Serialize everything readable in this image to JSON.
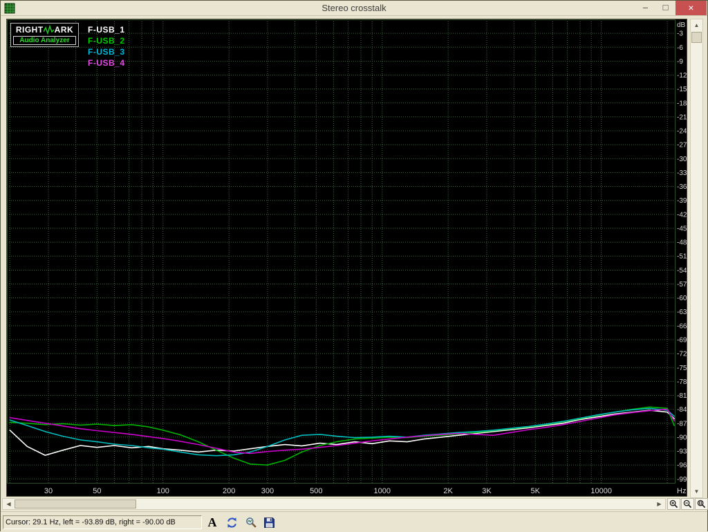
{
  "window": {
    "title": "Stereo crosstalk",
    "controls": {
      "minimize": "–",
      "maximize": "□",
      "close": "×"
    }
  },
  "legend": {
    "logo": {
      "line1_left": "RIGHT",
      "line1_right": "ARK",
      "line2": "Audio Analyzer"
    },
    "items": [
      {
        "label": "F-USB_1",
        "color": "#ffffff"
      },
      {
        "label": "F-USB_2",
        "color": "#00cc00"
      },
      {
        "label": "F-USB_3",
        "color": "#00b8d8"
      },
      {
        "label": "F-USB_4",
        "color": "#e44ae4"
      }
    ]
  },
  "scrollbars": {
    "up": "▲",
    "down": "▼",
    "left": "◀",
    "right": "▶"
  },
  "status": {
    "cursor_text": "Cursor:  29.1 Hz,  left = -93.89 dB,  right = -90.00 dB",
    "font_button": "A"
  },
  "icons": [
    "app-icon",
    "waveform-icon",
    "scroll-arrows",
    "zoom-in-icon",
    "zoom-out-icon",
    "zoom-full-icon",
    "font-icon",
    "refresh-icon",
    "analyze-icon",
    "save-icon"
  ],
  "chart_data": {
    "type": "line",
    "title": "Stereo crosstalk",
    "x_unit": "Hz",
    "y_unit": "dB",
    "x_scale": "log",
    "xlim": [
      19.4,
      21800
    ],
    "ylim": [
      -100,
      0
    ],
    "bg": "#000000",
    "grid_color": "#3f6b3f",
    "axis_text_color": "#d9d9d9",
    "grid_on": true,
    "legend_position": "top-left",
    "grid_freqs": [
      20,
      30,
      40,
      50,
      60,
      70,
      80,
      90,
      100,
      200,
      300,
      400,
      500,
      600,
      700,
      800,
      900,
      1000,
      2000,
      3000,
      4000,
      5000,
      6000,
      7000,
      8000,
      9000,
      10000,
      20000
    ],
    "x_ticks": [
      {
        "f": 30,
        "label": "30"
      },
      {
        "f": 50,
        "label": "50"
      },
      {
        "f": 100,
        "label": "100"
      },
      {
        "f": 200,
        "label": "200"
      },
      {
        "f": 300,
        "label": "300"
      },
      {
        "f": 500,
        "label": "500"
      },
      {
        "f": 1000,
        "label": "1000"
      },
      {
        "f": 2000,
        "label": "2K"
      },
      {
        "f": 3000,
        "label": "3K"
      },
      {
        "f": 5000,
        "label": "5K"
      },
      {
        "f": 10000,
        "label": "10000"
      }
    ],
    "y_ticks": [
      -3,
      -6,
      -9,
      -12,
      -15,
      -18,
      -21,
      -24,
      -27,
      -30,
      -33,
      -36,
      -39,
      -42,
      -45,
      -48,
      -51,
      -54,
      -57,
      -60,
      -63,
      -66,
      -69,
      -72,
      -75,
      -78,
      -81,
      -84,
      -87,
      -90,
      -93,
      -96,
      -99
    ],
    "x": [
      20,
      24,
      29,
      35,
      42,
      50,
      60,
      72,
      86,
      100,
      120,
      145,
      175,
      210,
      250,
      300,
      360,
      430,
      520,
      620,
      750,
      900,
      1080,
      1300,
      1550,
      1860,
      2230,
      2680,
      3220,
      3860,
      4640,
      5570,
      6680,
      8020,
      9620,
      11500,
      13900,
      16600,
      20000,
      21500
    ],
    "series": [
      {
        "name": "F-USB_1",
        "color": "#ffffff",
        "values": [
          -88.5,
          -92.0,
          -93.9,
          -92.8,
          -91.8,
          -92.2,
          -91.8,
          -92.3,
          -92.0,
          -92.5,
          -92.8,
          -93.2,
          -92.8,
          -93.0,
          -92.5,
          -92.0,
          -91.6,
          -91.9,
          -91.3,
          -91.6,
          -91.0,
          -91.4,
          -90.8,
          -91.0,
          -90.4,
          -90.0,
          -89.6,
          -89.2,
          -88.8,
          -88.4,
          -88.0,
          -87.5,
          -87.0,
          -86.2,
          -85.6,
          -85.0,
          -84.6,
          -84.2,
          -84.6,
          -86.0
        ]
      },
      {
        "name": "F-USB_2",
        "color": "#00b400",
        "values": [
          -86.8,
          -87.0,
          -87.3,
          -87.1,
          -87.4,
          -87.2,
          -87.5,
          -87.3,
          -87.8,
          -88.5,
          -89.5,
          -91.0,
          -92.8,
          -94.5,
          -95.8,
          -96.0,
          -95.0,
          -93.2,
          -91.8,
          -91.0,
          -90.4,
          -90.2,
          -90.0,
          -90.1,
          -89.8,
          -89.6,
          -89.3,
          -89.0,
          -88.6,
          -88.2,
          -87.8,
          -87.3,
          -86.7,
          -86.0,
          -85.3,
          -84.6,
          -84.0,
          -83.5,
          -83.8,
          -87.5
        ]
      },
      {
        "name": "F-USB_3",
        "color": "#00bcbc",
        "values": [
          -86.3,
          -87.5,
          -88.8,
          -89.8,
          -90.6,
          -91.0,
          -91.5,
          -91.8,
          -92.3,
          -92.6,
          -93.2,
          -93.8,
          -94.0,
          -93.8,
          -93.2,
          -92.0,
          -90.6,
          -89.6,
          -89.4,
          -89.8,
          -90.1,
          -90.0,
          -89.8,
          -90.0,
          -89.6,
          -89.3,
          -89.0,
          -88.8,
          -88.5,
          -88.1,
          -87.7,
          -87.2,
          -86.6,
          -85.9,
          -85.2,
          -84.6,
          -84.1,
          -83.8,
          -84.2,
          -85.5
        ]
      },
      {
        "name": "F-USB_4",
        "color": "#cc00cc",
        "values": [
          -85.8,
          -86.4,
          -87.0,
          -87.6,
          -88.2,
          -88.6,
          -89.0,
          -89.4,
          -89.9,
          -90.3,
          -90.9,
          -91.6,
          -92.4,
          -93.2,
          -93.5,
          -93.1,
          -92.8,
          -92.6,
          -92.2,
          -91.8,
          -91.3,
          -90.8,
          -90.4,
          -90.0,
          -89.7,
          -89.4,
          -89.2,
          -89.4,
          -89.6,
          -89.0,
          -88.4,
          -87.9,
          -87.3,
          -86.6,
          -85.9,
          -85.2,
          -84.7,
          -84.3,
          -84.0,
          -86.5
        ]
      }
    ]
  }
}
